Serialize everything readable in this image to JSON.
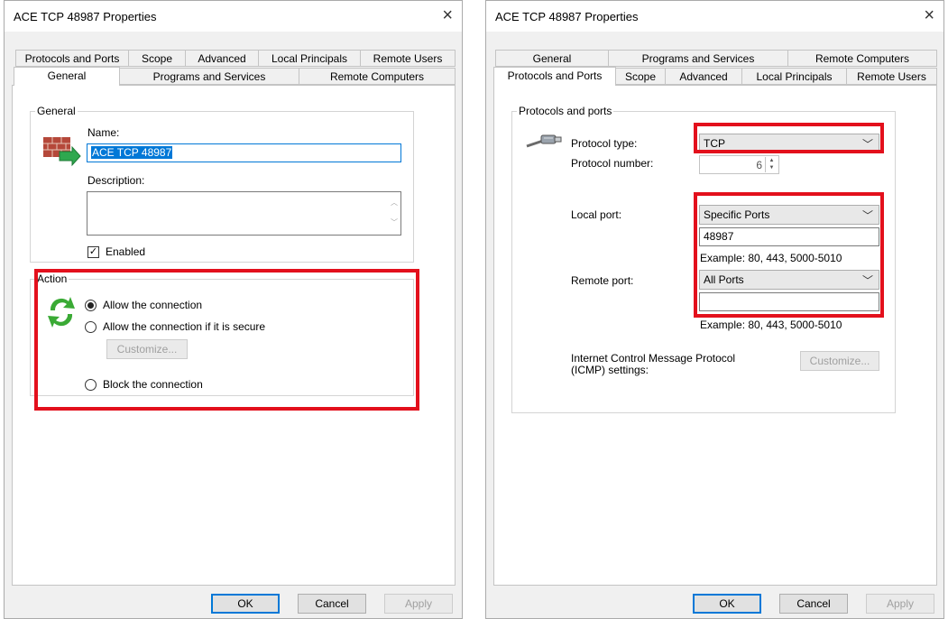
{
  "left": {
    "title": "ACE TCP 48987 Properties",
    "close": "×",
    "tabs_row1": [
      "Protocols and Ports",
      "Scope",
      "Advanced",
      "Local Principals",
      "Remote Users"
    ],
    "tabs_row2": [
      "General",
      "Programs and Services",
      "Remote Computers"
    ],
    "active_tab": "General",
    "general": {
      "legend": "General",
      "name_label": "Name:",
      "name_value": "ACE TCP 48987",
      "description_label": "Description:",
      "description_value": "",
      "enabled_label": "Enabled",
      "enabled_checked": true,
      "enabled_mark": "✓"
    },
    "action": {
      "legend": "Action",
      "allow_label": "Allow the connection",
      "allow_secure_label": "Allow the connection if it is secure",
      "customize_label": "Customize...",
      "block_label": "Block the connection",
      "selected": "allow"
    },
    "buttons": {
      "ok": "OK",
      "cancel": "Cancel",
      "apply": "Apply"
    }
  },
  "right": {
    "title": "ACE TCP 48987 Properties",
    "close": "×",
    "tabs_row1": [
      "General",
      "Programs and Services",
      "Remote Computers"
    ],
    "tabs_row2": [
      "Protocols and Ports",
      "Scope",
      "Advanced",
      "Local Principals",
      "Remote Users"
    ],
    "active_tab": "Protocols and Ports",
    "protocols": {
      "legend": "Protocols and ports",
      "protocol_type_label": "Protocol type:",
      "protocol_type_value": "TCP",
      "protocol_number_label": "Protocol number:",
      "protocol_number_value": "6",
      "local_port_label": "Local port:",
      "local_port_select": "Specific Ports",
      "local_port_value": "48987",
      "local_example": "Example: 80, 443, 5000-5010",
      "remote_port_label": "Remote port:",
      "remote_port_select": "All Ports",
      "remote_port_value": "",
      "remote_example": "Example: 80, 443, 5000-5010",
      "icmp_label_line1": "Internet Control Message Protocol",
      "icmp_label_line2": "(ICMP) settings:",
      "icmp_customize": "Customize..."
    },
    "buttons": {
      "ok": "OK",
      "cancel": "Cancel",
      "apply": "Apply"
    }
  },
  "colors": {
    "highlight": "#e3101c",
    "accent": "#0078d7"
  },
  "icons": {
    "firewall": "firewall-icon",
    "action": "action-arrows-icon",
    "cable": "network-cable-icon",
    "chevron": "chevron-down-icon"
  }
}
